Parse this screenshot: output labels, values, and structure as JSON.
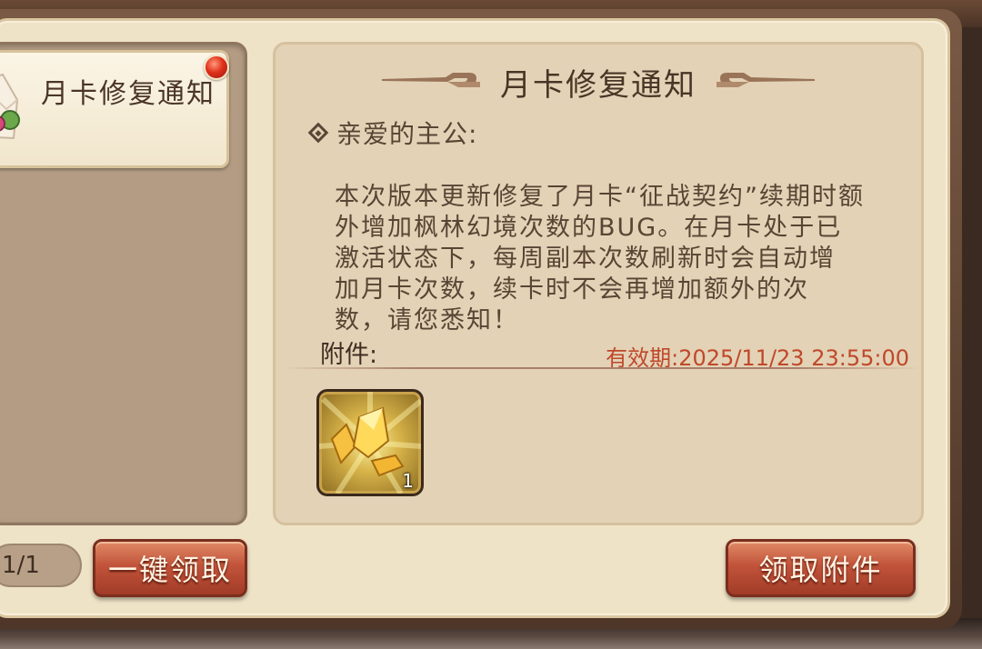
{
  "mail_list": {
    "items": [
      {
        "title": "月卡修复通知",
        "unread": true
      }
    ],
    "page_indicator": "1/1",
    "claim_all_label": "一键领取"
  },
  "mail_detail": {
    "title": "月卡修复通知",
    "greeting": "亲爱的主公:",
    "body_lines": [
      "本次版本更新修复了月卡“征战契约”续期时额",
      "外增加枫林幻境次数的BUG。在月卡处于已",
      "激活状态下，每周副本次数刷新时会自动增",
      "加月卡次数，续卡时不会再增加额外的次",
      "数，请您悉知！"
    ],
    "attachments_label": "附件:",
    "validity": "有效期:2025/11/23 23:55:00",
    "attachments": [
      {
        "icon": "yellow-crystal-icon",
        "count": "1"
      }
    ],
    "claim_label": "领取附件"
  },
  "colors": {
    "panel": "#efe3c7",
    "detail_bg": "#e3d2b6",
    "button": "#c1533a",
    "validity_text": "#c0482a"
  }
}
